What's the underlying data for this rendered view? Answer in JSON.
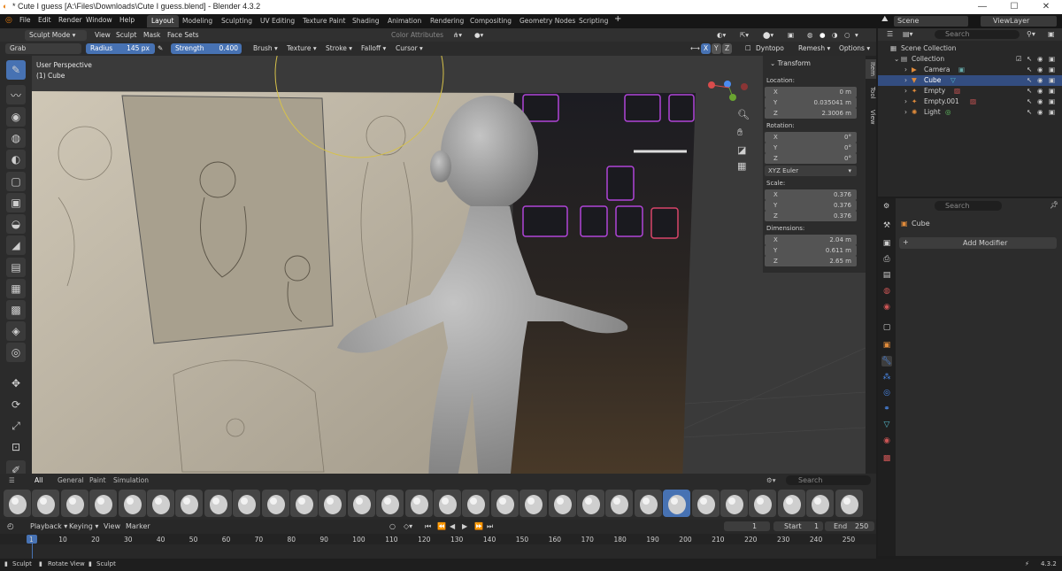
{
  "title_bar": {
    "title": "* Cute I guess [A:\\Files\\Downloads\\Cute I guess.blend] - Blender 4.3.2"
  },
  "menu": [
    "File",
    "Edit",
    "Render",
    "Window",
    "Help"
  ],
  "workspaces": [
    "Layout",
    "Modeling",
    "Sculpting",
    "UV Editing",
    "Texture Paint",
    "Shading",
    "Animation",
    "Rendering",
    "Compositing",
    "Geometry Nodes",
    "Scripting"
  ],
  "scene": {
    "name": "Scene",
    "view_layer": "ViewLayer"
  },
  "header": {
    "mode": "Sculpt Mode",
    "menus": [
      "View",
      "Sculpt",
      "Mask",
      "Face Sets"
    ],
    "color_attributes": "Color Attributes"
  },
  "tool_settings": {
    "brush": "Grab",
    "radius_label": "Radius",
    "radius_value": "145 px",
    "strength_label": "Strength",
    "strength_value": "0.400",
    "menus": [
      "Brush",
      "Texture",
      "Stroke",
      "Falloff",
      "Cursor"
    ],
    "axes": [
      "X",
      "Y",
      "Z"
    ],
    "dyntopo": "Dyntopo",
    "remesh": "Remesh",
    "options": "Options"
  },
  "viewport": {
    "view": "User Perspective",
    "object": "(1) Cube"
  },
  "transform": {
    "title": "Transform",
    "location_label": "Location:",
    "location": [
      {
        "axis": "X",
        "value": "0 m"
      },
      {
        "axis": "Y",
        "value": "0.035041 m"
      },
      {
        "axis": "Z",
        "value": "2.3006 m"
      }
    ],
    "rotation_label": "Rotation:",
    "rotation": [
      {
        "axis": "X",
        "value": "0°"
      },
      {
        "axis": "Y",
        "value": "0°"
      },
      {
        "axis": "Z",
        "value": "0°"
      }
    ],
    "rotation_mode": "XYZ Euler",
    "scale_label": "Scale:",
    "scale": [
      {
        "axis": "X",
        "value": "0.376"
      },
      {
        "axis": "Y",
        "value": "0.376"
      },
      {
        "axis": "Z",
        "value": "0.376"
      }
    ],
    "dimensions_label": "Dimensions:",
    "dimensions": [
      {
        "axis": "X",
        "value": "2.04 m"
      },
      {
        "axis": "Y",
        "value": "0.611 m"
      },
      {
        "axis": "Z",
        "value": "2.65 m"
      }
    ]
  },
  "side_tabs": [
    "Item",
    "Tool",
    "View"
  ],
  "outliner": {
    "search_placeholder": "Search",
    "items": [
      {
        "label": "Scene Collection",
        "icon": "scene-collection-icon"
      },
      {
        "label": "Collection",
        "icon": "collection-icon"
      },
      {
        "label": "Camera",
        "icon": "camera-icon"
      },
      {
        "label": "Cube",
        "icon": "mesh-icon"
      },
      {
        "label": "Empty",
        "icon": "empty-icon"
      },
      {
        "label": "Empty.001",
        "icon": "empty-icon"
      },
      {
        "label": "Light",
        "icon": "light-icon"
      }
    ]
  },
  "properties": {
    "search_placeholder": "Search",
    "object": "Cube",
    "add_modifier": "Add Modifier"
  },
  "asset_shelf": {
    "tabs": [
      "All",
      "General",
      "Paint",
      "Simulation"
    ],
    "search_placeholder": "Search",
    "brush_count": 30,
    "selected_brush": 23
  },
  "timeline": {
    "menus": [
      "Playback",
      "Keying",
      "View",
      "Marker"
    ],
    "current_frame": "1",
    "start_label": "Start",
    "start": "1",
    "end_label": "End",
    "end": "250",
    "ticks": [
      "1",
      "10",
      "20",
      "30",
      "40",
      "50",
      "60",
      "70",
      "80",
      "90",
      "100",
      "110",
      "120",
      "130",
      "140",
      "150",
      "160",
      "170",
      "180",
      "190",
      "200",
      "210",
      "220",
      "230",
      "240",
      "250"
    ]
  },
  "status_bar": {
    "items": [
      "Sculpt",
      "Rotate View",
      "Sculpt"
    ],
    "version": "4.3.2"
  },
  "colors": {
    "accent": "#4772b3",
    "selection": "#334d80",
    "background": "#1d1d1d"
  }
}
